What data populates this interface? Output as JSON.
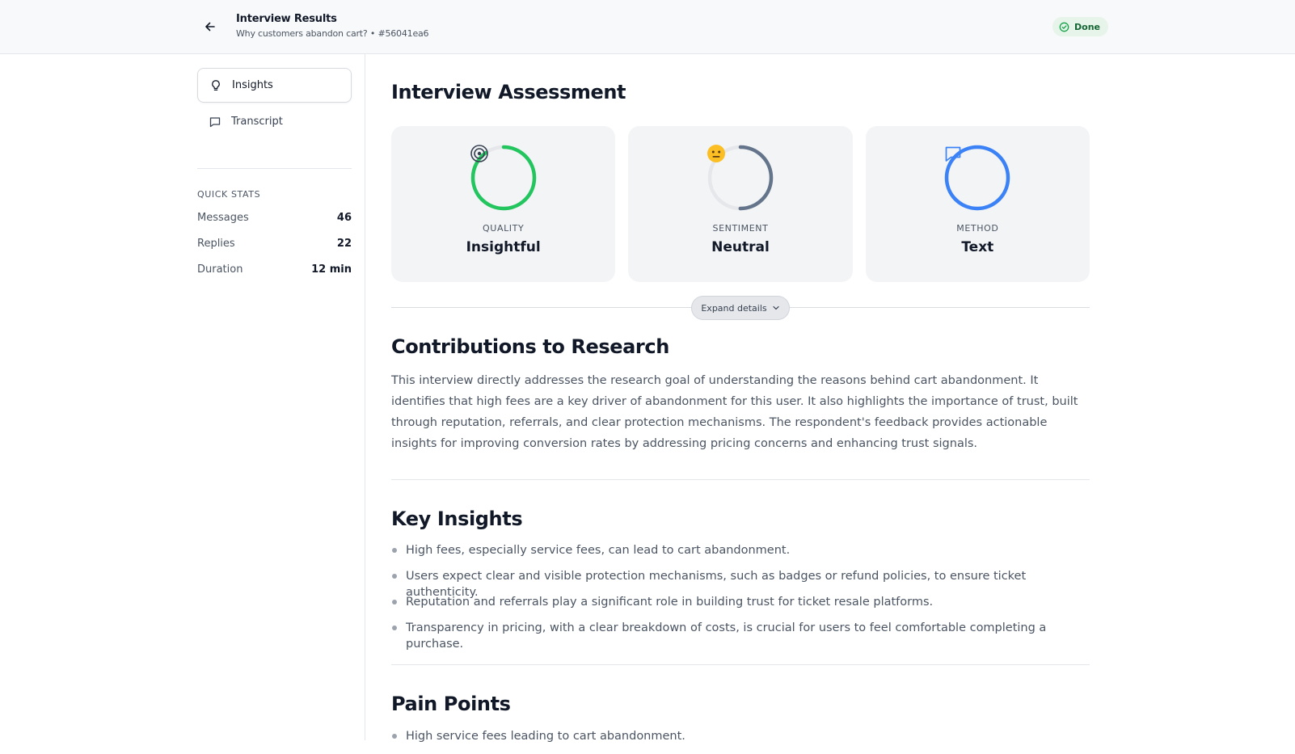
{
  "header": {
    "title": "Interview Results",
    "subtitle": "Why customers abandon cart? • #56041ea6",
    "status": "Done"
  },
  "sidebar": {
    "items": [
      {
        "label": "Insights",
        "icon": "lightbulb-icon",
        "active": true
      },
      {
        "label": "Transcript",
        "icon": "chat-icon",
        "active": false
      }
    ],
    "quick_stats_title": "QUICK STATS",
    "stats": [
      {
        "label": "Messages",
        "value": "46"
      },
      {
        "label": "Replies",
        "value": "22"
      },
      {
        "label": "Duration",
        "value": "12 min"
      }
    ]
  },
  "assessment": {
    "title": "Interview Assessment",
    "cards": [
      {
        "label": "QUALITY",
        "value": "Insightful",
        "icon": "target-icon",
        "color": "#22c55e",
        "fill": 0.9
      },
      {
        "label": "SENTIMENT",
        "value": "Neutral",
        "icon": "neutral-face-icon",
        "color": "#64748b",
        "fill": 0.5
      },
      {
        "label": "METHOD",
        "value": "Text",
        "icon": "chat-icon",
        "color": "#3b82f6",
        "fill": 1.0
      }
    ],
    "expand_label": "Expand details"
  },
  "contributions": {
    "title": "Contributions to Research",
    "text": "This interview directly addresses the research goal of understanding the reasons behind cart abandonment. It identifies that high fees are a key driver of abandonment for this user. It also highlights the importance of trust, built through reputation, referrals, and clear protection mechanisms. The respondent's feedback provides actionable insights for improving conversion rates by addressing pricing concerns and enhancing trust signals."
  },
  "key_insights": {
    "title": "Key Insights",
    "items": [
      "High fees, especially service fees, can lead to cart abandonment.",
      "Users expect clear and visible protection mechanisms, such as badges or refund policies, to ensure ticket authenticity.",
      "Reputation and referrals play a significant role in building trust for ticket resale platforms.",
      "Transparency in pricing, with a clear breakdown of costs, is crucial for users to feel comfortable completing a purchase."
    ]
  },
  "pain_points": {
    "title": "Pain Points",
    "items": [
      "High service fees leading to cart abandonment."
    ]
  }
}
